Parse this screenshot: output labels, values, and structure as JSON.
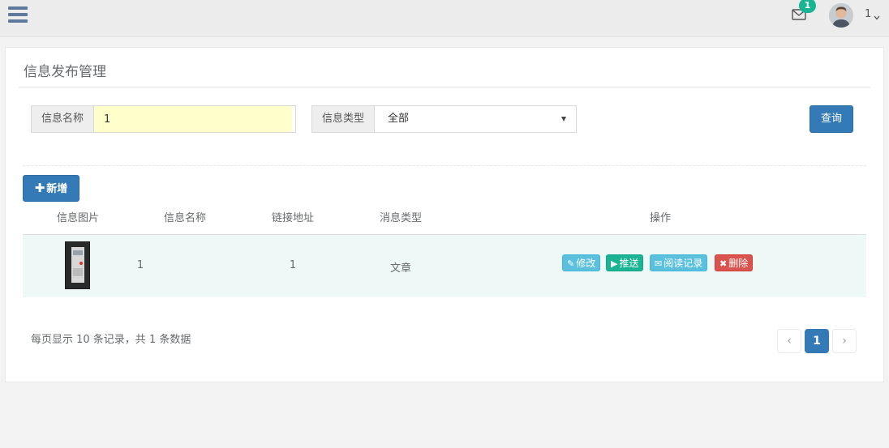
{
  "topbar": {
    "notification_count": "1",
    "username": "1",
    "menu_icon": "hamburger-icon",
    "mail_icon": "envelope-icon",
    "dropdown_icon": "chevron-down-icon",
    "badge_color": "#1ab394"
  },
  "page": {
    "title": "信息发布管理"
  },
  "filters": {
    "name_label": "信息名称",
    "name_value": "1",
    "type_label": "信息类型",
    "type_value": "全部",
    "query_label": "查询"
  },
  "toolbar": {
    "add_label": "新增",
    "add_icon": "plus-icon",
    "primary_color": "#337ab7"
  },
  "table": {
    "headers": [
      "信息图片",
      "信息名称",
      "链接地址",
      "消息类型",
      "操作"
    ],
    "rows": [
      {
        "name": "1",
        "link": "1",
        "type": "文章",
        "actions": {
          "edit": "修改",
          "push": "推送",
          "read_log": "阅读记录",
          "delete": "删除"
        }
      }
    ]
  },
  "footer": {
    "summary": "每页显示 10 条记录，共 1 条数据",
    "current_page": "1",
    "prev_symbol": "‹",
    "next_symbol": "›"
  }
}
